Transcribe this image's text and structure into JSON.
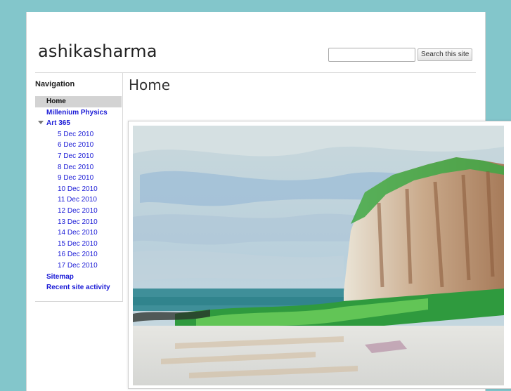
{
  "site": {
    "title": "ashikasharma"
  },
  "search": {
    "placeholder": "",
    "button_label": "Search this site"
  },
  "navigation": {
    "heading": "Navigation",
    "items": [
      {
        "label": "Home",
        "level": 1,
        "current": true
      },
      {
        "label": "Millenium Physics",
        "level": 1
      },
      {
        "label": "Art 365",
        "level": 1,
        "expanded": true
      },
      {
        "label": "5 Dec 2010",
        "level": 2
      },
      {
        "label": "6 Dec 2010",
        "level": 2
      },
      {
        "label": "7 Dec 2010",
        "level": 2
      },
      {
        "label": "8 Dec 2010",
        "level": 2
      },
      {
        "label": "9 Dec 2010",
        "level": 2
      },
      {
        "label": "10 Dec 2010",
        "level": 2
      },
      {
        "label": "11 Dec 2010",
        "level": 2
      },
      {
        "label": "12 Dec 2010",
        "level": 2
      },
      {
        "label": "13 Dec 2010",
        "level": 2
      },
      {
        "label": "14 Dec 2010",
        "level": 2
      },
      {
        "label": "15 Dec 2010",
        "level": 2
      },
      {
        "label": "16 Dec 2010",
        "level": 2
      },
      {
        "label": "17 Dec 2010",
        "level": 2
      },
      {
        "label": "Sitemap",
        "level": 1
      },
      {
        "label": "Recent site activity",
        "level": 1
      }
    ]
  },
  "main": {
    "heading": "Home"
  },
  "colors": {
    "background": "#83c6cb",
    "link": "#1a1ad6",
    "current_item_bg": "#d3d3d3"
  }
}
